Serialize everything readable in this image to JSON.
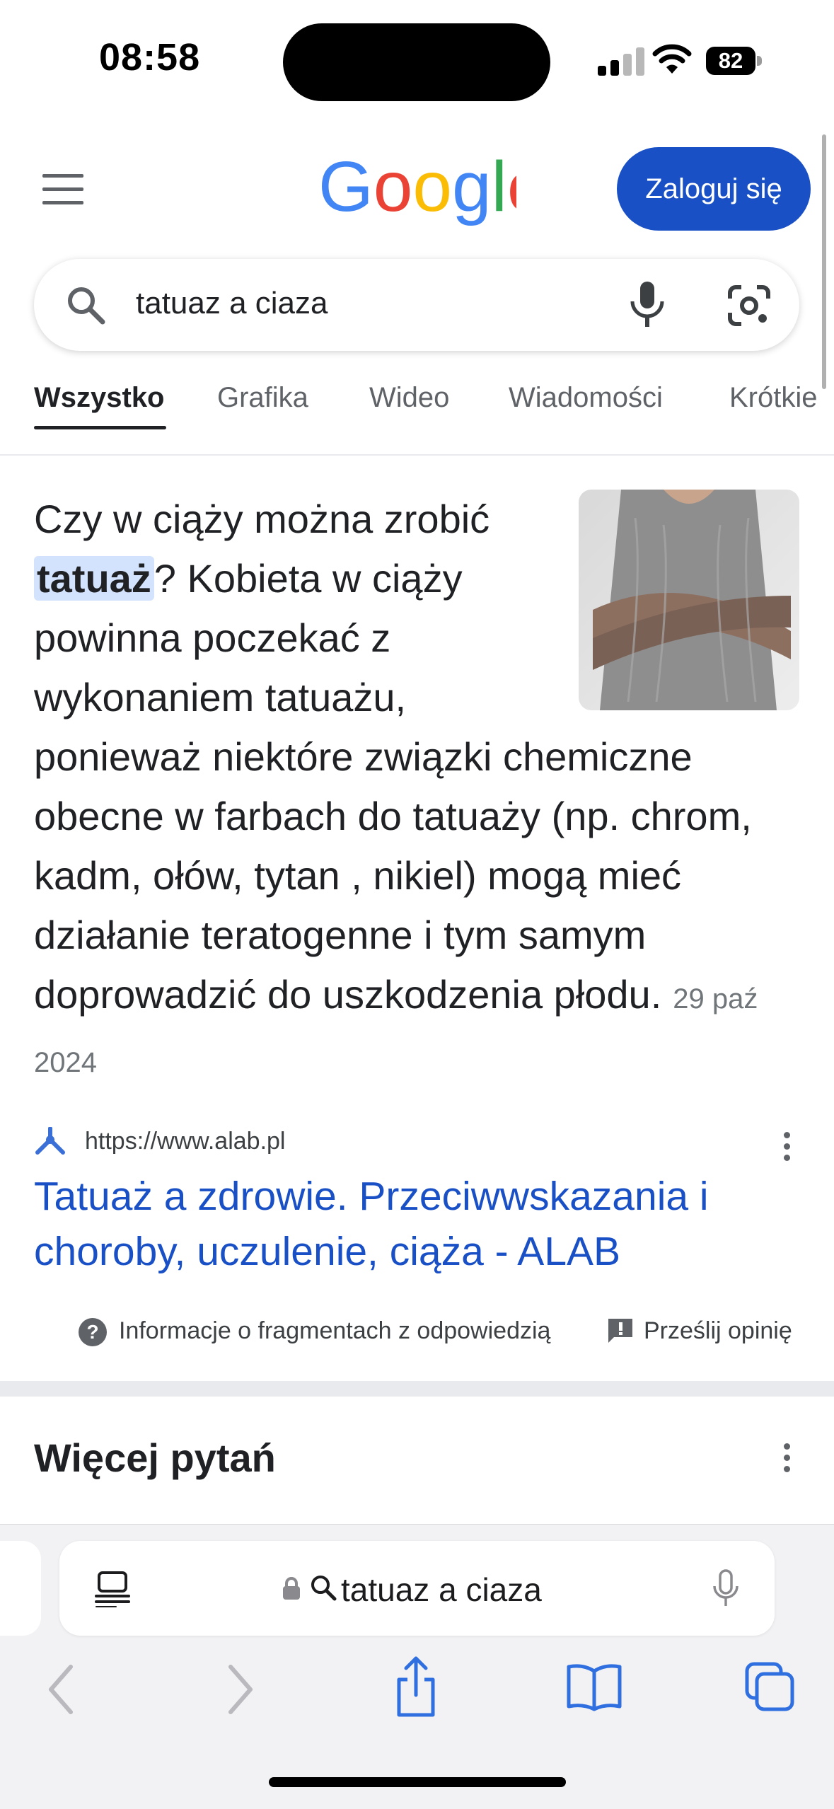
{
  "status_bar": {
    "time": "08:58",
    "battery": "82"
  },
  "header": {
    "logo_letters": [
      "G",
      "o",
      "o",
      "g",
      "l",
      "e"
    ],
    "login_label": "Zaloguj się"
  },
  "search": {
    "query": "tatuaz a ciaza"
  },
  "tabs": [
    {
      "label": "Wszystko",
      "active": true
    },
    {
      "label": "Grafika"
    },
    {
      "label": "Wideo"
    },
    {
      "label": "Wiadomości"
    },
    {
      "label": "Krótkie"
    }
  ],
  "snippet": {
    "pre": "Czy w ciąży można zrobić ",
    "highlight": "tatuaż",
    "post": "? Kobieta w ciąży powinna poczekać z wykonaniem tatuażu, ponieważ niektóre związki chemiczne obecne w farbach do tatuaży (np. chrom, kadm, ołów, tytan , nikiel) mogą mieć działanie teratogenne i tym samym doprowadzić do uszkodzenia płodu.",
    "date": "29 paź 2024"
  },
  "result": {
    "url": "https://www.alab.pl",
    "title": "Tatuaż a zdrowie. Przeciwwskazania i choroby, uczulenie, ciąża - ALAB"
  },
  "footer": {
    "help_label": "Informacje o fragmentach z odpowiedzią",
    "feedback_label": "Prześlij opinię"
  },
  "more_questions": {
    "title": "Więcej pytań"
  },
  "safari": {
    "address": "tatuaz a ciaza"
  },
  "colors": {
    "accent_blue": "#1a50c6",
    "highlight": "#d3e3fd",
    "google_blue": "#4285f4",
    "google_red": "#ea4335",
    "google_yellow": "#fbbc05",
    "google_green": "#34a853"
  }
}
